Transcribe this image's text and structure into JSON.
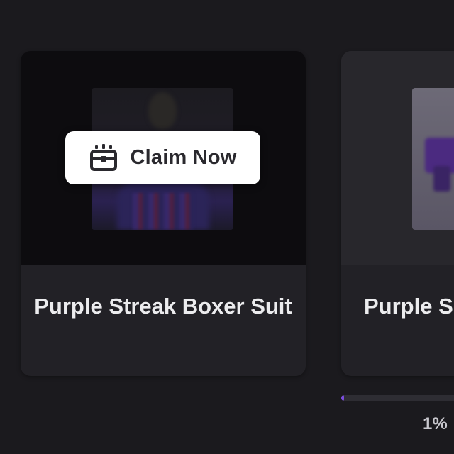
{
  "cards": [
    {
      "title": "Purple Streak Boxer Suit",
      "claim_label": "Claim Now",
      "claim_icon": "treasure-chest-icon"
    },
    {
      "title": "Purple S",
      "progress_percent": 1,
      "progress_label": "1%"
    }
  ],
  "colors": {
    "background": "#1b1a1e",
    "card": "#222126",
    "accent": "#7b4dde",
    "button": "#ffffff"
  }
}
